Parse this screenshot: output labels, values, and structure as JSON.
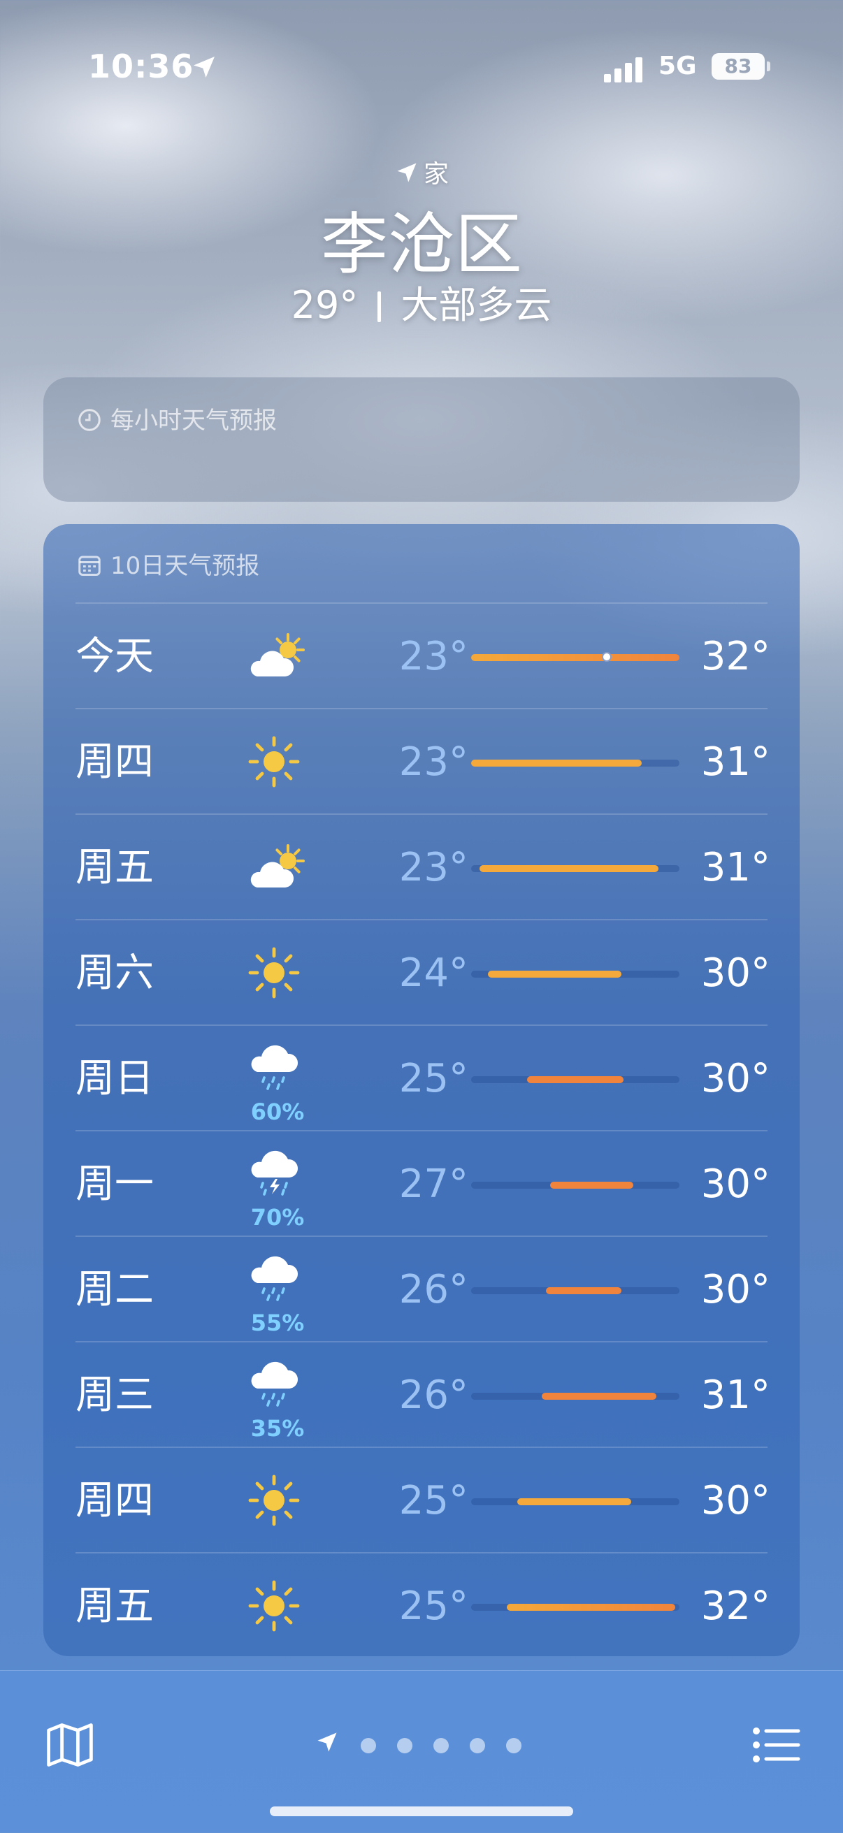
{
  "status_bar": {
    "time": "10:36",
    "network": "5G",
    "battery": "83"
  },
  "header": {
    "location_tag": "家",
    "city": "李沧区",
    "current_temp": "29°",
    "condition": "大部多云"
  },
  "hourly": {
    "title": "每小时天气预报"
  },
  "daily": {
    "title": "10日天气预报",
    "days": [
      {
        "day": "今天",
        "icon": "partly-cloudy-day-icon",
        "precip": "",
        "low": "23°",
        "high": "32°",
        "bar_start": 0.0,
        "bar_end": 1.0,
        "current_dot": 0.65
      },
      {
        "day": "周四",
        "icon": "sun-icon",
        "precip": "",
        "low": "23°",
        "high": "31°",
        "bar_start": 0.0,
        "bar_end": 0.82
      },
      {
        "day": "周五",
        "icon": "partly-cloudy-day-icon",
        "precip": "",
        "low": "23°",
        "high": "31°",
        "bar_start": 0.04,
        "bar_end": 0.9
      },
      {
        "day": "周六",
        "icon": "sun-icon",
        "precip": "",
        "low": "24°",
        "high": "30°",
        "bar_start": 0.08,
        "bar_end": 0.72
      },
      {
        "day": "周日",
        "icon": "rain-cloud-icon",
        "precip": "60%",
        "low": "25°",
        "high": "30°",
        "bar_start": 0.27,
        "bar_end": 0.73
      },
      {
        "day": "周一",
        "icon": "thunderstorm-icon",
        "precip": "70%",
        "low": "27°",
        "high": "30°",
        "bar_start": 0.38,
        "bar_end": 0.78
      },
      {
        "day": "周二",
        "icon": "rain-cloud-icon",
        "precip": "55%",
        "low": "26°",
        "high": "30°",
        "bar_start": 0.36,
        "bar_end": 0.72
      },
      {
        "day": "周三",
        "icon": "rain-cloud-icon",
        "precip": "35%",
        "low": "26°",
        "high": "31°",
        "bar_start": 0.34,
        "bar_end": 0.89
      },
      {
        "day": "周四",
        "icon": "sun-icon",
        "precip": "",
        "low": "25°",
        "high": "30°",
        "bar_start": 0.22,
        "bar_end": 0.77
      },
      {
        "day": "周五",
        "icon": "sun-icon",
        "precip": "",
        "low": "25°",
        "high": "32°",
        "bar_start": 0.17,
        "bar_end": 0.98
      }
    ]
  },
  "bottom_bar": {
    "map_icon": "map-icon",
    "list_icon": "list-icon",
    "page_dots": 5
  },
  "colors": {
    "bar_warm": "#f4a93a",
    "bar_hot": "#f0843c",
    "precip": "#7fd0ff",
    "low_temp": "#9cc2f3"
  }
}
